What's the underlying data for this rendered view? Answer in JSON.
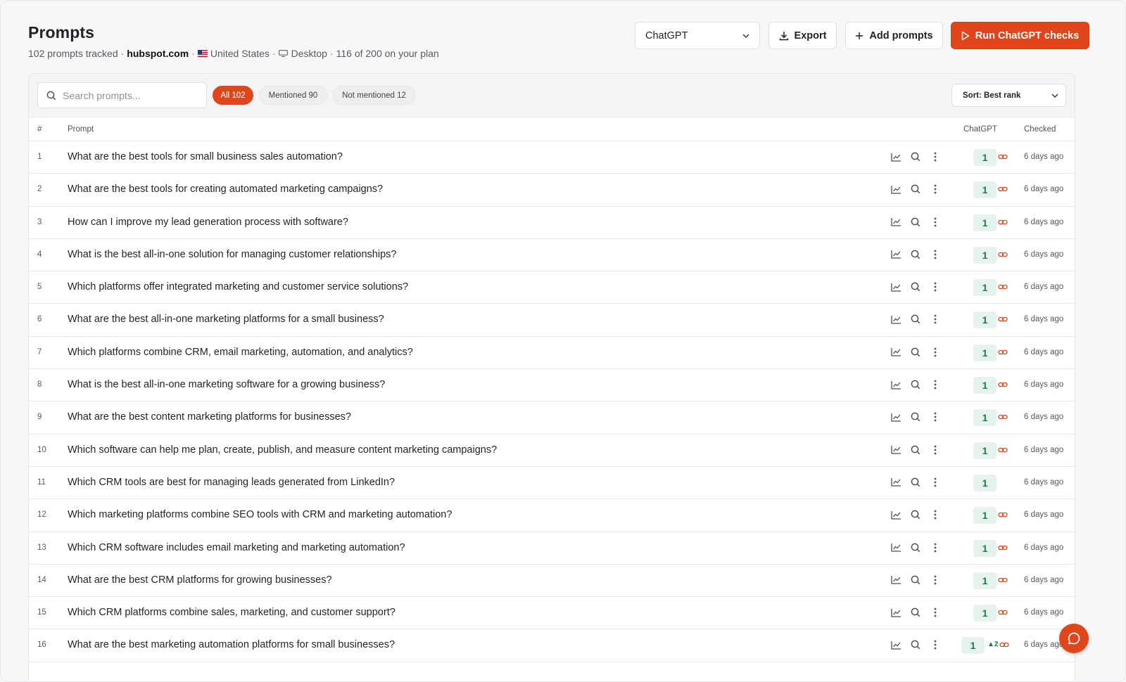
{
  "header": {
    "title": "Prompts",
    "tracked": "102 prompts tracked",
    "domain": "hubspot.com",
    "country": "United States",
    "device": "Desktop",
    "plan": "116 of 200 on your plan",
    "engine_select": "ChatGPT",
    "export_label": "Export",
    "add_label": "Add prompts",
    "run_label": "Run ChatGPT checks"
  },
  "filters": {
    "search_placeholder": "Search prompts...",
    "chips": [
      "All 102",
      "Mentioned 90",
      "Not mentioned 12"
    ],
    "active_chip": "All 102",
    "sort_label": "Sort: Best rank"
  },
  "table": {
    "columns": {
      "num": "#",
      "prompt": "Prompt",
      "engine": "ChatGPT",
      "checked": "Checked"
    },
    "rows": [
      {
        "num": "1",
        "prompt": "What are the best tools for small business sales automation?",
        "rank": "1",
        "delta": "",
        "link": true,
        "checked": "6 days ago"
      },
      {
        "num": "2",
        "prompt": "What are the best tools for creating automated marketing campaigns?",
        "rank": "1",
        "delta": "",
        "link": true,
        "checked": "6 days ago"
      },
      {
        "num": "3",
        "prompt": "How can I improve my lead generation process with software?",
        "rank": "1",
        "delta": "",
        "link": true,
        "checked": "6 days ago"
      },
      {
        "num": "4",
        "prompt": "What is the best all-in-one solution for managing customer relationships?",
        "rank": "1",
        "delta": "",
        "link": true,
        "checked": "6 days ago"
      },
      {
        "num": "5",
        "prompt": "Which platforms offer integrated marketing and customer service solutions?",
        "rank": "1",
        "delta": "",
        "link": true,
        "checked": "6 days ago"
      },
      {
        "num": "6",
        "prompt": "What are the best all-in-one marketing platforms for a small business?",
        "rank": "1",
        "delta": "",
        "link": true,
        "checked": "6 days ago"
      },
      {
        "num": "7",
        "prompt": "Which platforms combine CRM, email marketing, automation, and analytics?",
        "rank": "1",
        "delta": "",
        "link": true,
        "checked": "6 days ago"
      },
      {
        "num": "8",
        "prompt": "What is the best all-in-one marketing software for a growing business?",
        "rank": "1",
        "delta": "",
        "link": true,
        "checked": "6 days ago"
      },
      {
        "num": "9",
        "prompt": "What are the best content marketing platforms for businesses?",
        "rank": "1",
        "delta": "",
        "link": true,
        "checked": "6 days ago"
      },
      {
        "num": "10",
        "prompt": "Which software can help me plan, create, publish, and measure content marketing campaigns?",
        "rank": "1",
        "delta": "",
        "link": true,
        "checked": "6 days ago"
      },
      {
        "num": "11",
        "prompt": "Which CRM tools are best for managing leads generated from LinkedIn?",
        "rank": "1",
        "delta": "",
        "link": false,
        "checked": "6 days ago"
      },
      {
        "num": "12",
        "prompt": "Which marketing platforms combine SEO tools with CRM and marketing automation?",
        "rank": "1",
        "delta": "",
        "link": true,
        "checked": "6 days ago"
      },
      {
        "num": "13",
        "prompt": "Which CRM software includes email marketing and marketing automation?",
        "rank": "1",
        "delta": "",
        "link": true,
        "checked": "6 days ago"
      },
      {
        "num": "14",
        "prompt": "What are the best CRM platforms for growing businesses?",
        "rank": "1",
        "delta": "",
        "link": true,
        "checked": "6 days ago"
      },
      {
        "num": "15",
        "prompt": "Which CRM platforms combine sales, marketing, and customer support?",
        "rank": "1",
        "delta": "",
        "link": true,
        "checked": "6 days ago"
      },
      {
        "num": "16",
        "prompt": "What are the best marketing automation platforms for small businesses?",
        "rank": "1",
        "delta": "▲2",
        "link": true,
        "checked": "6 days ago"
      }
    ]
  },
  "icons": {
    "trend": "trend-chart-icon",
    "search": "search-icon",
    "more": "more-vertical-icon",
    "link": "link-icon",
    "chat": "chat-icon"
  },
  "colors": {
    "accent": "#e0461c",
    "rank_bg": "#e6f3ed",
    "rank_text": "#1d7a4e"
  }
}
